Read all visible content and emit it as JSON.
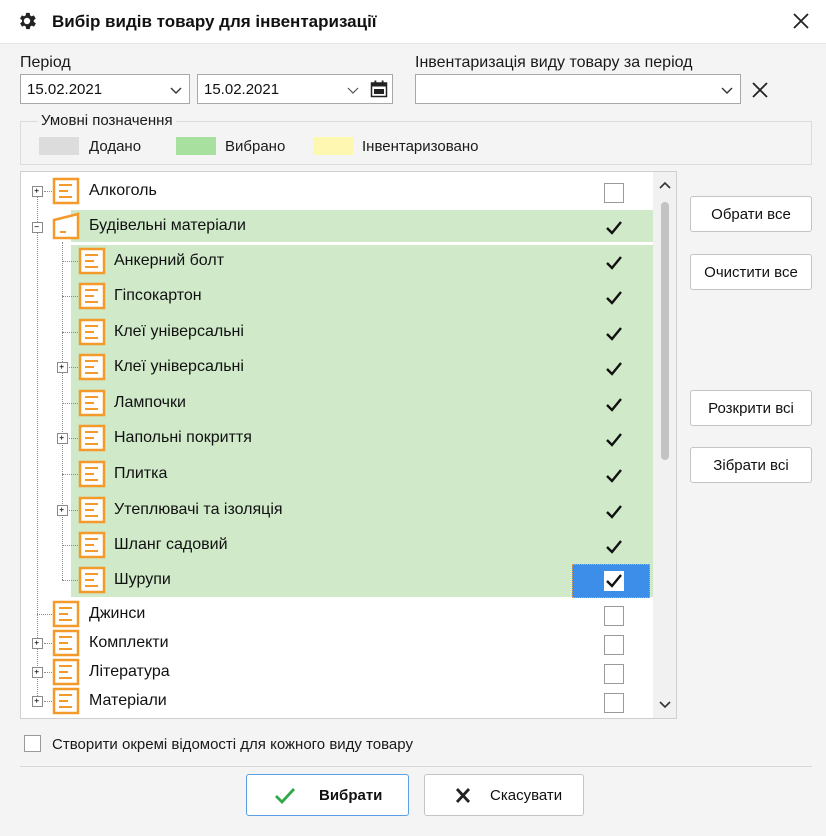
{
  "title": "Вибір видів товару для інвентаризації",
  "period": {
    "label": "Період",
    "date_from": "15.02.2021",
    "date_to": "15.02.2021"
  },
  "inventory": {
    "label": "Інвентаризація виду товару за період",
    "value": ""
  },
  "legend": {
    "title": "Умовні позначення",
    "items": [
      {
        "label": "Додано",
        "color": "#dcdcdc"
      },
      {
        "label": "Вибрано",
        "color": "#a8e0a0"
      },
      {
        "label": "Інвентаризовано",
        "color": "#fdf7b2"
      }
    ]
  },
  "tree": {
    "items": [
      {
        "label": "Алкоголь",
        "checked": false
      },
      {
        "label": "Будівельні матеріали",
        "checked": true
      },
      {
        "label": "Анкерний болт",
        "checked": true
      },
      {
        "label": "Гіпсокартон",
        "checked": true
      },
      {
        "label": "Клеї універсальні",
        "checked": true
      },
      {
        "label": "Клеї універсальні",
        "checked": true
      },
      {
        "label": "Лампочки",
        "checked": true
      },
      {
        "label": "Напольні покриття",
        "checked": true
      },
      {
        "label": "Плитка",
        "checked": true
      },
      {
        "label": "Утеплювачі та ізоляція",
        "checked": true
      },
      {
        "label": "Шланг садовий",
        "checked": true
      },
      {
        "label": "Шурупи",
        "checked": true
      },
      {
        "label": "Джинси",
        "checked": false
      },
      {
        "label": "Комплекти",
        "checked": false
      },
      {
        "label": "Література",
        "checked": false
      },
      {
        "label": "Матеріали",
        "checked": false
      }
    ]
  },
  "buttons": {
    "select_all": "Обрати все",
    "clear_all": "Очистити все",
    "expand_all": "Розкрити всі",
    "collapse_all": "Зібрати всі"
  },
  "separate_docs_label": "Створити окремі відомості для кожного виду товару",
  "footer": {
    "ok": "Вибрати",
    "cancel": "Скасувати"
  },
  "colors": {
    "accent": "#3d8ee8",
    "folder": "#f39a2a",
    "selected_row": "#cfe9c9"
  }
}
